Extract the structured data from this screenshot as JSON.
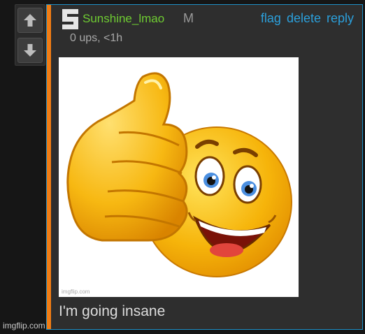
{
  "vote": {
    "upvote_icon": "arrow-up-icon",
    "downvote_icon": "arrow-down-icon"
  },
  "comment": {
    "avatar_letter": "S",
    "username": "Sunshine_lmao",
    "mod_tag": "M",
    "meta": "0 ups, <1h",
    "actions": {
      "flag": "flag",
      "delete": "delete",
      "reply": "reply"
    },
    "image": {
      "description": "thumbs-up-emoji",
      "watermark": "imgflip.com"
    },
    "text": "I'm going insane"
  },
  "site_watermark": "imgflip.com",
  "colors": {
    "background": "#161616",
    "comment_bg": "#2e2e2e",
    "accent": "#f07c14",
    "border": "#1e90c8",
    "username": "#6fcc32",
    "link": "#2ba0dc",
    "emoji_yellow": "#f6b40a"
  }
}
